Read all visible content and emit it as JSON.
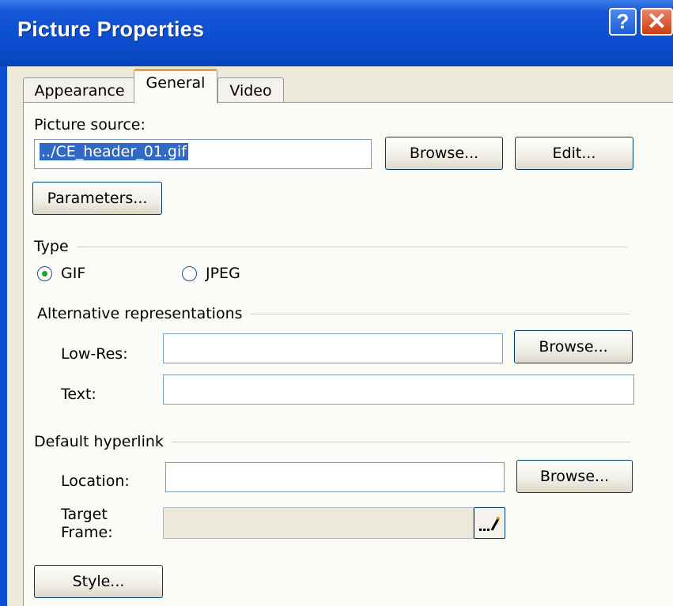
{
  "window": {
    "title": "Picture Properties",
    "help_label": "?",
    "close_label": "✕"
  },
  "tabs": [
    {
      "label": "Appearance",
      "active": false
    },
    {
      "label": "General",
      "active": true
    },
    {
      "label": "Video",
      "active": false
    }
  ],
  "picture_source": {
    "label": "Picture source:",
    "value": "../CE_header_01.gif",
    "browse_label": "Browse...",
    "edit_label": "Edit..."
  },
  "parameters_label": "Parameters...",
  "type": {
    "label": "Type",
    "options": [
      {
        "label": "GIF",
        "checked": true
      },
      {
        "label": "JPEG",
        "checked": false
      }
    ]
  },
  "alternative": {
    "label": "Alternative representations",
    "lowres_label": "Low-Res:",
    "lowres_value": "",
    "browse_label": "Browse...",
    "text_label": "Text:",
    "text_value": ""
  },
  "hyperlink": {
    "label": "Default hyperlink",
    "location_label": "Location:",
    "location_value": "",
    "browse_label": "Browse...",
    "target_label_line1": "Target",
    "target_label_line2": "Frame:",
    "target_value": "",
    "target_button_icon": "ellipsis-pencil-icon"
  },
  "style_label": "Style...",
  "colors": {
    "title_bar": "#0b4fd2",
    "dialog_bg": "#ece9d8",
    "selection": "#316ac5",
    "active_tab_accent": "#e8a33c",
    "radio_dot": "#21a121"
  }
}
